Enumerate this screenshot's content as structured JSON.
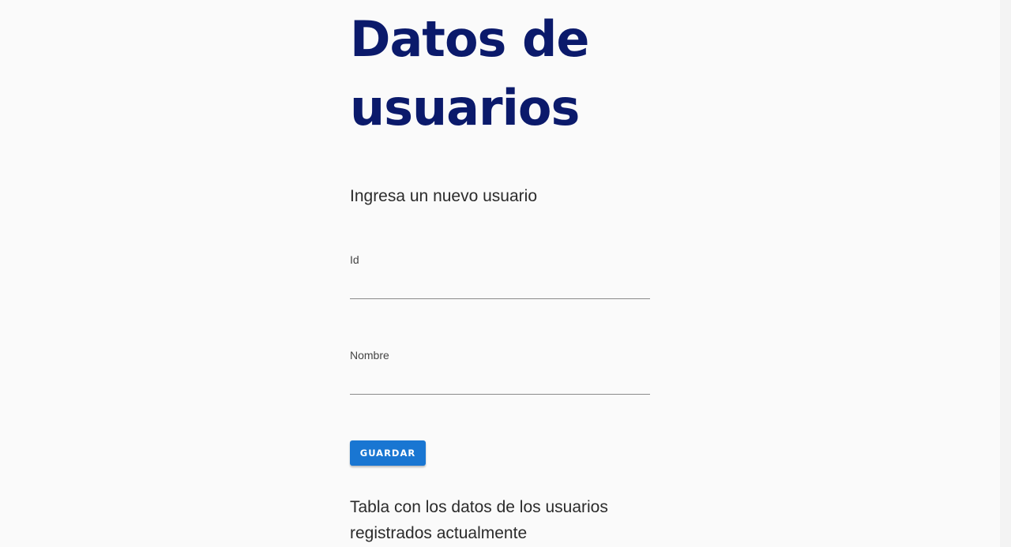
{
  "page": {
    "title": "Datos de usuarios"
  },
  "form": {
    "heading": "Ingresa un nuevo usuario",
    "fields": [
      {
        "label": "Id",
        "value": ""
      },
      {
        "label": "Nombre",
        "value": ""
      }
    ],
    "save_label": "GUARDAR"
  },
  "table": {
    "heading": "Tabla con los datos de los usuarios registrados actualmente"
  },
  "colors": {
    "title": "#0b1a6b",
    "button": "#1976d2",
    "background": "#fafafa"
  }
}
